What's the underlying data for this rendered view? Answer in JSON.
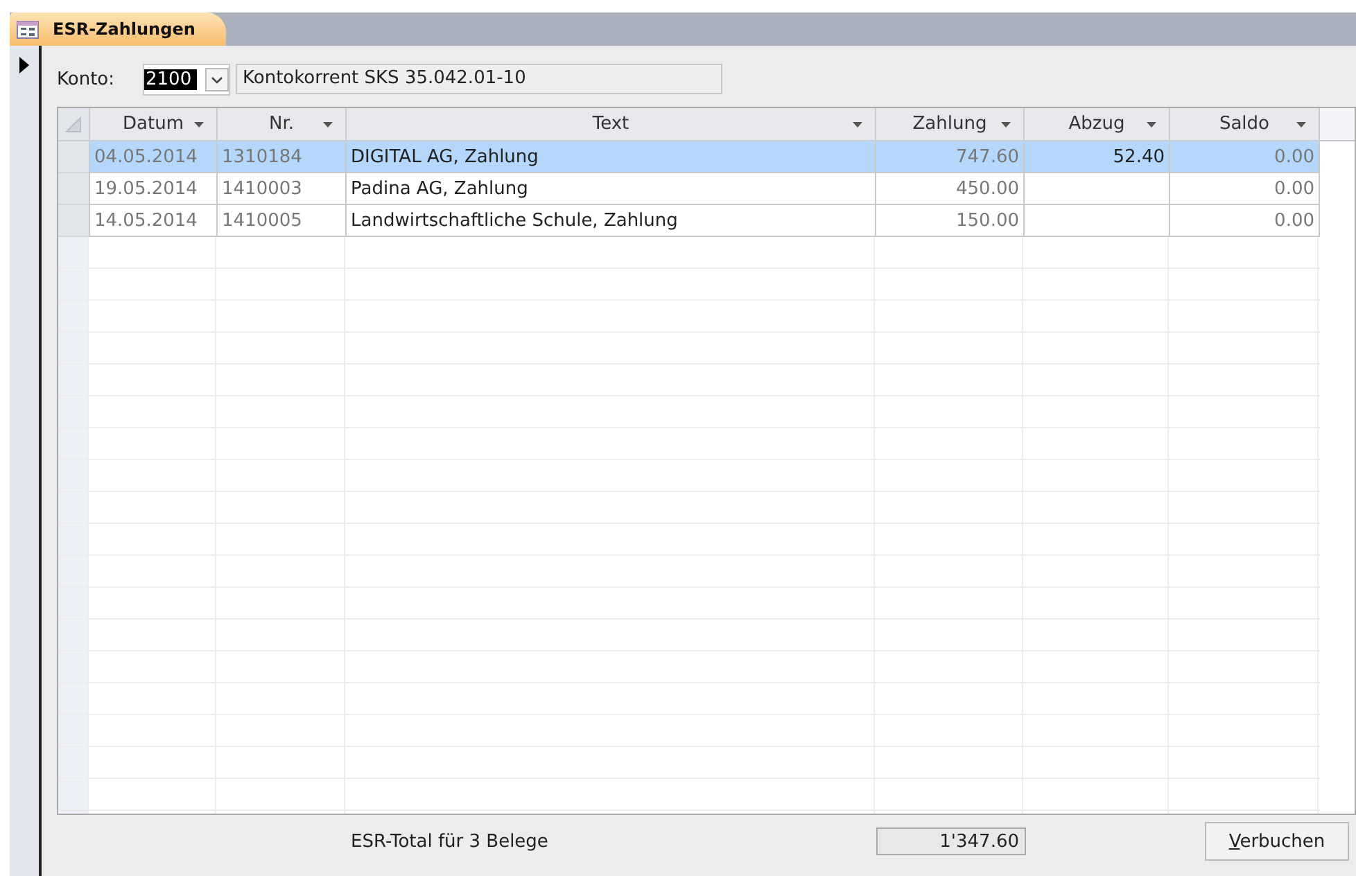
{
  "tab": {
    "title": "ESR-Zahlungen",
    "selected": true
  },
  "konto": {
    "label": "Konto:",
    "value": "2100",
    "description": "Kontokorrent SKS 35.042.01-10"
  },
  "table": {
    "columns": [
      {
        "label": "Datum"
      },
      {
        "label": "Nr."
      },
      {
        "label": "Text"
      },
      {
        "label": "Zahlung"
      },
      {
        "label": "Abzug"
      },
      {
        "label": "Saldo"
      }
    ],
    "rows": [
      {
        "selected": true,
        "cells": [
          "04.05.2014",
          "1310184",
          "DIGITAL AG, Zahlung",
          "747.60",
          "52.40",
          "0.00"
        ]
      },
      {
        "selected": false,
        "cells": [
          "19.05.2014",
          "1410003",
          "Padina AG, Zahlung",
          "450.00",
          "",
          "0.00"
        ]
      },
      {
        "selected": false,
        "cells": [
          "14.05.2014",
          "1410005",
          "Landwirtschaftliche Schule, Zahlung",
          "150.00",
          "",
          "0.00"
        ]
      }
    ]
  },
  "footer": {
    "label": "ESR-Total für 3 Belege",
    "total": "1'347.60",
    "button": "Verbuchen"
  }
}
